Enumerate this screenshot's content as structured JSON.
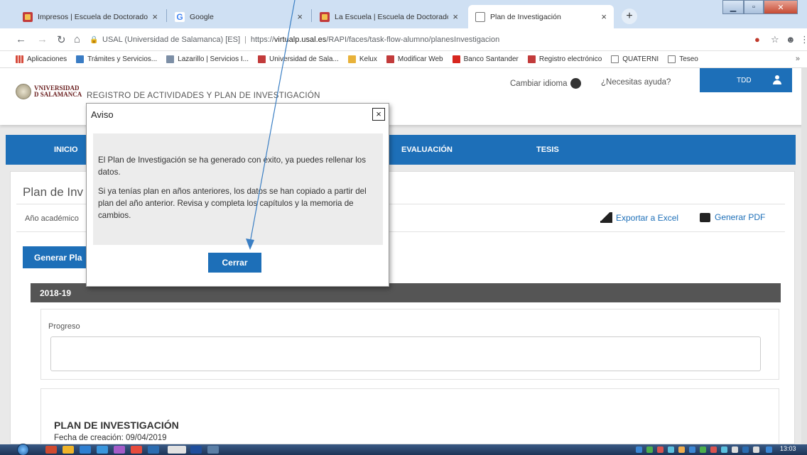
{
  "browser": {
    "tabs": [
      {
        "title": "Impresos | Escuela de Doctorado",
        "favicon": "usal-favicon"
      },
      {
        "title": "Google",
        "favicon": "google-favicon"
      },
      {
        "title": "La Escuela | Escuela de Doctorado",
        "favicon": "usal-favicon"
      },
      {
        "title": "Plan de Investigación",
        "favicon": "document-favicon"
      }
    ],
    "tab_close_glyph": "×",
    "new_tab_glyph": "+",
    "url": {
      "secure_label": "USAL (Universidad de Salamanca) [ES]",
      "scheme": "https://",
      "host": "virtualp.usal.es",
      "path": "/RAPI/faces/task-flow-alumno/planesInvestigacion"
    },
    "bookmarks": [
      {
        "label": "Aplicaciones",
        "icon": "apps-grid-icon"
      },
      {
        "label": "Trámites y Servicios...",
        "icon": "tramites-icon"
      },
      {
        "label": "Lazarillo | Servicios I...",
        "icon": "lazarillo-icon"
      },
      {
        "label": "Universidad de Sala...",
        "icon": "usal-favicon"
      },
      {
        "label": "Kelux",
        "icon": "kelux-icon"
      },
      {
        "label": "Modificar Web",
        "icon": "usal-favicon"
      },
      {
        "label": "Banco Santander",
        "icon": "santander-icon"
      },
      {
        "label": "Registro electrónico",
        "icon": "usal-favicon"
      },
      {
        "label": "QUATERNI",
        "icon": "document-favicon"
      },
      {
        "label": "Teseo",
        "icon": "document-favicon"
      }
    ],
    "bookmarks_overflow": "»"
  },
  "header": {
    "logo_line1": "VNIVERSIDAD",
    "logo_line2": "D SALAMANCA",
    "site_title": "REGISTRO DE ACTIVIDADES Y PLAN DE INVESTIGACIÓN",
    "change_language": "Cambiar idioma",
    "help": "¿Necesitas ayuda?",
    "user": "TDD"
  },
  "nav": {
    "items": [
      "INICIO",
      "EVALUACIÓN",
      "TESIS"
    ]
  },
  "content": {
    "heading": "Plan de Inv",
    "year_label": "Año académico",
    "export_excel": "Exportar a Excel",
    "generate_pdf": "Generar PDF",
    "generate_plan_button": "Generar Pla",
    "year_bar": "2018-19",
    "progress_label": "Progreso",
    "plan_title": "PLAN DE INVESTIGACIÓN",
    "creation_date": "Fecha de creación: 09/04/2019"
  },
  "modal": {
    "title": "Aviso",
    "close_glyph": "×",
    "paragraph1": "El Plan de Investigación se ha generado con éxito, ya puedes rellenar los datos.",
    "paragraph2": "Si ya tenías plan en años anteriores, los datos se han copiado a partir del plan del año anterior. Revisa y completa los capítulos y la memoria de cambios.",
    "ok_button": "Cerrar"
  },
  "taskbar": {
    "clock": "13:03"
  },
  "colors": {
    "primary_blue": "#1d6fb8",
    "year_bar_gray": "#555555",
    "annotation_arrow": "#3b7fc4"
  }
}
